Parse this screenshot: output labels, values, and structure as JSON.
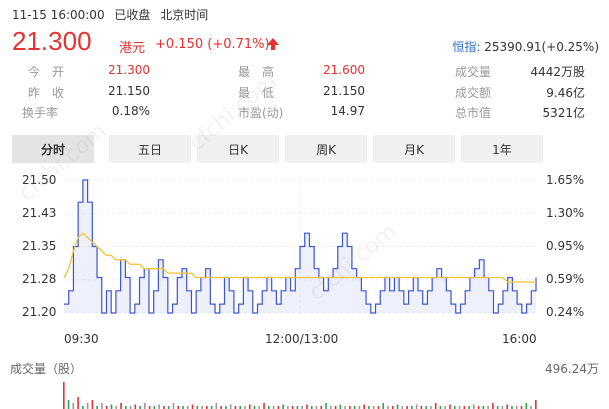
{
  "header": {
    "datetime": "11-15 16:00:00",
    "status": "已收盘",
    "timezone": "北京时间",
    "price": "21.300",
    "currency": "港元",
    "change": "+0.150",
    "change_pct": "(+0.71%)",
    "index_label": "恒指:",
    "index_value": "25390.91(+0.25%)",
    "up_color": "#e93030"
  },
  "quote": {
    "open_label": "今　开",
    "open_value": "21.300",
    "prev_label": "昨　收",
    "prev_value": "21.150",
    "turnover_label": "换手率",
    "turnover_value": "0.18%",
    "high_label": "最　高",
    "high_value": "21.600",
    "low_label": "最　低",
    "low_value": "21.150",
    "pe_label": "市盈(动)",
    "pe_value": "14.97",
    "volume_label": "成交量",
    "volume_value": "4442万股",
    "amount_label": "成交额",
    "amount_value": "9.46亿",
    "mktcap_label": "总市值",
    "mktcap_value": "5321亿"
  },
  "tabs": [
    "分时",
    "五日",
    "日K",
    "周K",
    "月K",
    "1年"
  ],
  "active_tab": 0,
  "volume": {
    "label": "成交量（股）",
    "max_label": "496.24万"
  },
  "watermark": "cfchi.com",
  "chart_data": {
    "type": "line",
    "y_ticks": [
      "21.50",
      "21.43",
      "21.35",
      "21.28",
      "21.20"
    ],
    "y_pct_ticks": [
      "1.65%",
      "1.30%",
      "0.95%",
      "0.59%",
      "0.24%"
    ],
    "x_ticks": [
      "09:30",
      "12:00/13:00",
      "16:00"
    ],
    "ylim": [
      21.2,
      21.5
    ],
    "series": [
      {
        "role": "price",
        "color": "#3a55d6",
        "values": [
          21.22,
          21.25,
          21.35,
          21.45,
          21.5,
          21.45,
          21.35,
          21.28,
          21.2,
          21.25,
          21.2,
          21.25,
          21.32,
          21.28,
          21.2,
          21.22,
          21.28,
          21.3,
          21.2,
          21.25,
          21.32,
          21.28,
          21.2,
          21.22,
          21.28,
          21.3,
          21.25,
          21.2,
          21.25,
          21.28,
          21.3,
          21.22,
          21.2,
          21.22,
          21.28,
          21.25,
          21.2,
          21.22,
          21.28,
          21.25,
          21.2,
          21.22,
          21.25,
          21.28,
          21.25,
          21.22,
          21.25,
          21.28,
          21.25,
          21.3,
          21.35,
          21.38,
          21.35,
          21.3,
          21.28,
          21.25,
          21.28,
          21.3,
          21.35,
          21.38,
          21.35,
          21.3,
          21.28,
          21.25,
          21.22,
          21.2,
          21.22,
          21.25,
          21.28,
          21.25,
          21.28,
          21.25,
          21.22,
          21.25,
          21.28,
          21.25,
          21.22,
          21.25,
          21.28,
          21.3,
          21.28,
          21.25,
          21.22,
          21.2,
          21.22,
          21.25,
          21.28,
          21.3,
          21.32,
          21.28,
          21.25,
          21.2,
          21.22,
          21.25,
          21.28,
          21.25,
          21.22,
          21.2,
          21.22,
          21.25,
          21.28
        ],
        "role_label": ""
      },
      {
        "role": "average",
        "color": "#f2c230",
        "values": [
          21.28,
          21.3,
          21.34,
          21.37,
          21.38,
          21.37,
          21.36,
          21.35,
          21.34,
          21.33,
          21.33,
          21.32,
          21.32,
          21.32,
          21.31,
          21.31,
          21.31,
          21.3,
          21.3,
          21.3,
          21.3,
          21.3,
          21.29,
          21.29,
          21.29,
          21.29,
          21.29,
          21.29,
          21.28,
          21.28,
          21.28,
          21.28,
          21.28,
          21.28,
          21.28,
          21.28,
          21.28,
          21.28,
          21.28,
          21.28,
          21.28,
          21.28,
          21.28,
          21.28,
          21.28,
          21.28,
          21.28,
          21.28,
          21.28,
          21.28,
          21.28,
          21.28,
          21.28,
          21.28,
          21.28,
          21.28,
          21.28,
          21.28,
          21.28,
          21.28,
          21.28,
          21.28,
          21.28,
          21.28,
          21.28,
          21.28,
          21.28,
          21.28,
          21.28,
          21.28,
          21.28,
          21.28,
          21.28,
          21.28,
          21.28,
          21.28,
          21.28,
          21.28,
          21.28,
          21.28,
          21.28,
          21.28,
          21.28,
          21.28,
          21.28,
          21.28,
          21.28,
          21.28,
          21.28,
          21.28,
          21.28,
          21.28,
          21.28,
          21.28,
          21.27,
          21.27,
          21.27,
          21.27,
          21.27,
          21.27,
          21.27
        ]
      }
    ],
    "volume_values": [
      0.9,
      0.3,
      0.2,
      0.4,
      0.1,
      0.2,
      0.3,
      0.1,
      0.2,
      0.1,
      0.15,
      0.1,
      0.2,
      0.1,
      0.1,
      0.15,
      0.1,
      0.2,
      0.1,
      0.1,
      0.15,
      0.1,
      0.1,
      0.2,
      0.1,
      0.1,
      0.1,
      0.15,
      0.1,
      0.1,
      0.1,
      0.1,
      0.2,
      0.1,
      0.1,
      0.15,
      0.1,
      0.1,
      0.1,
      0.15,
      0.1,
      0.1,
      0.2,
      0.1,
      0.1,
      0.1,
      0.15,
      0.1,
      0.1,
      0.1,
      0.1,
      0.15,
      0.1,
      0.1,
      0.1,
      0.2,
      0.1,
      0.1,
      0.15,
      0.1,
      0.1,
      0.1,
      0.1,
      0.15,
      0.1,
      0.1,
      0.1,
      0.2,
      0.1,
      0.1,
      0.15,
      0.1,
      0.1,
      0.1,
      0.15,
      0.1,
      0.1,
      0.1,
      0.2,
      0.1,
      0.1,
      0.15,
      0.1,
      0.1,
      0.1,
      0.1,
      0.15,
      0.1,
      0.1,
      0.1,
      0.2,
      0.1,
      0.1,
      0.15,
      0.1,
      0.1,
      0.1,
      0.2,
      0.1,
      0.3
    ]
  }
}
